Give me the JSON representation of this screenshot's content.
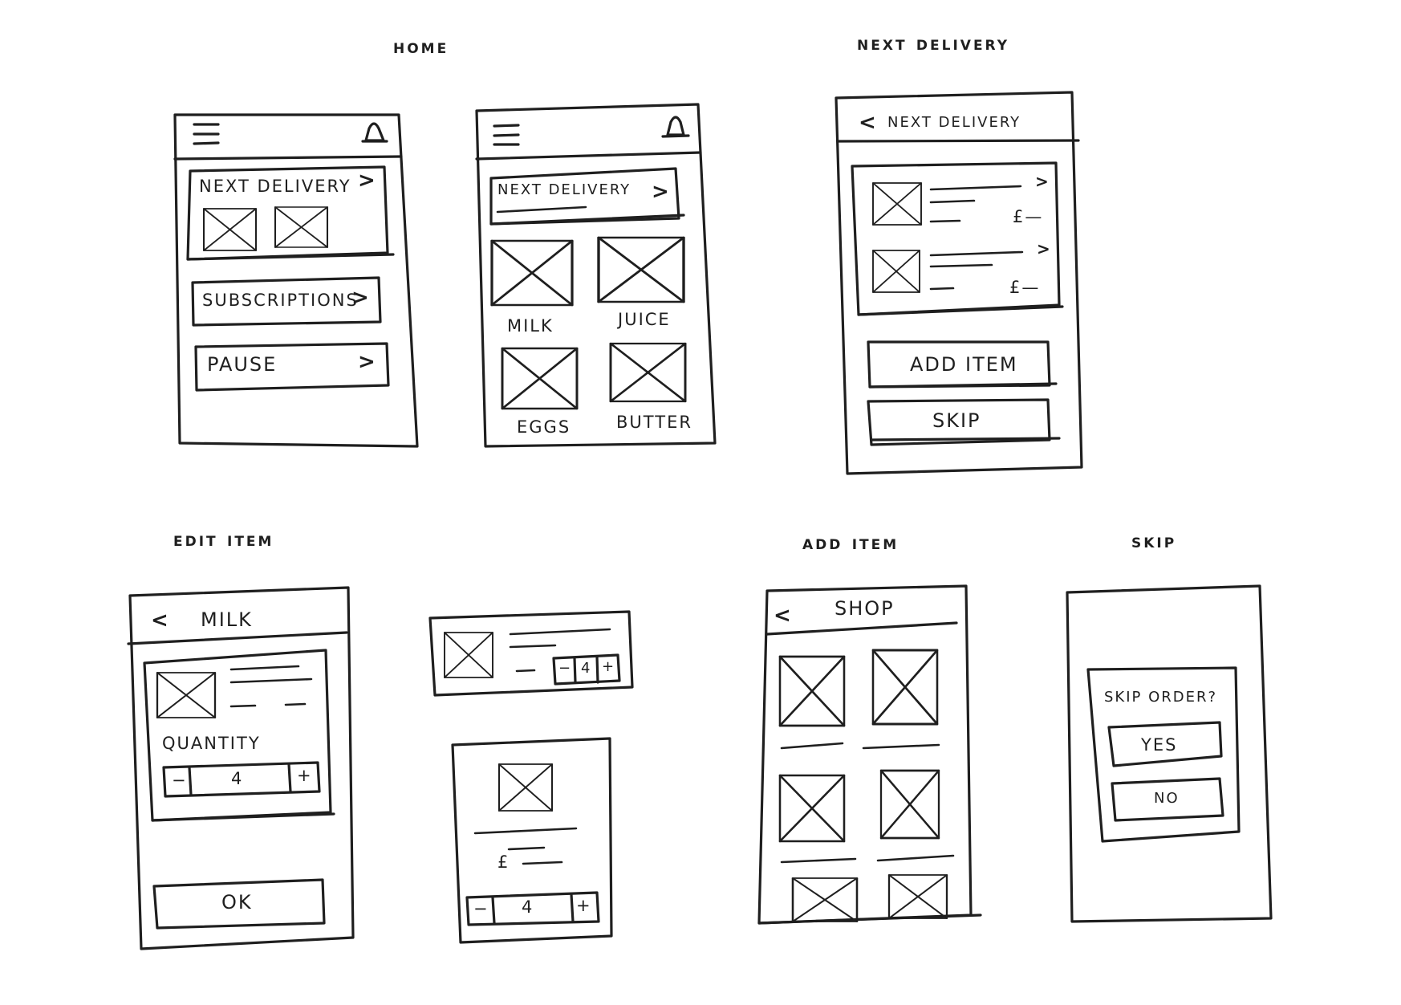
{
  "sections": {
    "home": "Home",
    "next_delivery": "Next Delivery",
    "edit_item": "Edit Item",
    "add_item": "Add Item",
    "skip": "Skip"
  },
  "home1": {
    "next_delivery": "Next Delivery",
    "subscriptions": "Subscriptions",
    "pause": "Pause",
    "chevron": ">"
  },
  "home2": {
    "next_delivery": "Next Delivery",
    "chevron": ">",
    "products": [
      "Milk",
      "Juice",
      "Eggs",
      "Butter"
    ]
  },
  "next_delivery_screen": {
    "back": "<",
    "title": "Next Delivery",
    "price_1": "£—",
    "price_2": "£—",
    "chevron": ">",
    "add_item": "Add Item",
    "skip": "Skip"
  },
  "edit_item_screen": {
    "back": "<",
    "title": "Milk",
    "quantity_label": "Quantity",
    "minus": "−",
    "quantity": "4",
    "plus": "+",
    "ok": "Ok"
  },
  "card_small": {
    "minus": "−",
    "quantity": "4",
    "plus": "+"
  },
  "card_large": {
    "price": "£",
    "minus": "−",
    "quantity": "4",
    "plus": "+"
  },
  "shop_screen": {
    "back": "<",
    "title": "Shop"
  },
  "skip_screen": {
    "question": "Skip order?",
    "yes": "Yes",
    "no": "No"
  },
  "icons": [
    "menu-icon",
    "bell-icon",
    "chevron-right-icon",
    "chevron-left-icon",
    "image-placeholder-icon"
  ],
  "colors": {
    "ink": "#1f1f1f",
    "paper": "#ffffff"
  }
}
